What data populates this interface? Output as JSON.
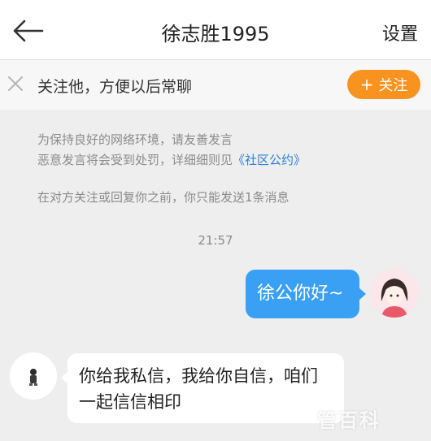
{
  "header": {
    "title": "徐志胜1995",
    "settings_label": "设置",
    "back_icon": "back-arrow-icon"
  },
  "follow_bar": {
    "text": "关注他，方便以后常聊",
    "button_plus": "+",
    "button_label": "关注",
    "button_color": "#f7931e",
    "close_icon": "close-icon"
  },
  "notice": {
    "line1": "为保持良好的网络环境，请友善发言",
    "line2_prefix": "恶意发言将会受到处罚，详细细则见",
    "line2_link": "《社区公约》",
    "limit": "在对方关注或回复你之前，你只能发送1条消息"
  },
  "chat": {
    "timestamp": "21:57",
    "sent_message": "徐公你好~",
    "received_message": "你给我私信，我给你自信，咱们一起信信相印",
    "sent_bubble_color": "#3aa0f3"
  },
  "watermark": "管百科"
}
